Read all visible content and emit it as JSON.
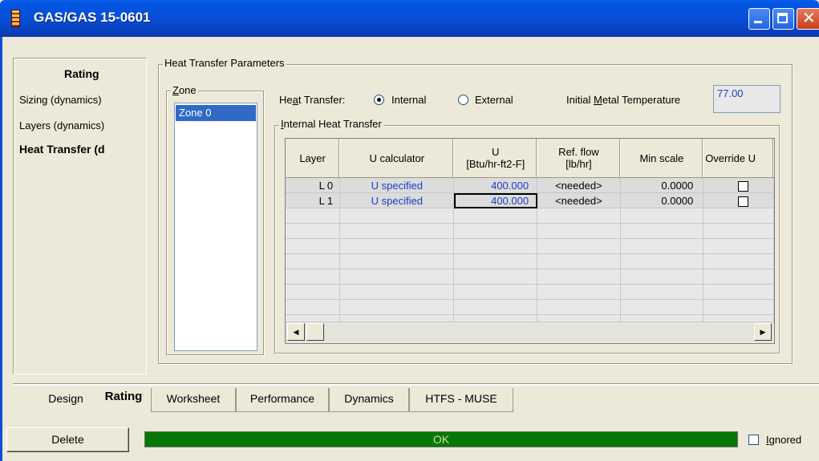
{
  "window": {
    "title": "GAS/GAS 15-0601"
  },
  "nav": {
    "header": "Rating",
    "items": [
      {
        "label": "Sizing (dynamics)"
      },
      {
        "label": "Layers (dynamics)"
      },
      {
        "label": "Heat Transfer (d"
      }
    ]
  },
  "heat_transfer_params": {
    "group_label": "Heat Transfer Parameters",
    "zone": {
      "group_label_prefix": "",
      "group_label_mnemonic": "Z",
      "group_label_rest": "one",
      "items": [
        "Zone 0"
      ]
    },
    "heat_transfer_label_prefix": "He",
    "heat_transfer_label_mnemonic": "a",
    "heat_transfer_label_rest": "t Transfer:",
    "radio_internal_label": "Internal",
    "radio_external_label": "External",
    "selected_mode": "Internal",
    "initial_metal_temp_label_prefix": "Initial ",
    "initial_metal_temp_label_mnemonic": "M",
    "initial_metal_temp_label_rest": "etal Temperature",
    "initial_metal_temp_value": "77.00"
  },
  "internal_heat_transfer": {
    "group_label_mnemonic": "I",
    "group_label_rest": "nternal Heat Transfer",
    "columns": [
      {
        "line1": "Layer",
        "line2": ""
      },
      {
        "line1": "U calculator",
        "line2": ""
      },
      {
        "line1": "U",
        "line2": "[Btu/hr-ft2-F]"
      },
      {
        "line1": "Ref. flow",
        "line2": "[lb/hr]"
      },
      {
        "line1": "Min scale",
        "line2": ""
      },
      {
        "line1": "Override U",
        "line2": ""
      }
    ],
    "rows": [
      {
        "layer": "L 0",
        "u_calculator": "U specified",
        "u": "400.000",
        "ref_flow": "<needed>",
        "min_scale": "0.0000",
        "override": false
      },
      {
        "layer": "L 1",
        "u_calculator": "U specified",
        "u": "400.000",
        "ref_flow": "<needed>",
        "min_scale": "0.0000",
        "override": false
      }
    ]
  },
  "tabs": [
    {
      "label": "Design"
    },
    {
      "label": "Rating"
    },
    {
      "label": "Worksheet"
    },
    {
      "label": "Performance"
    },
    {
      "label": "Dynamics"
    },
    {
      "label": "HTFS - MUSE"
    }
  ],
  "active_tab": "Rating",
  "bottom": {
    "delete_label": "Delete",
    "status_text": "OK",
    "ignored_label_mnemonic": "I",
    "ignored_label_rest": "gnored",
    "status_color": "#057805"
  }
}
